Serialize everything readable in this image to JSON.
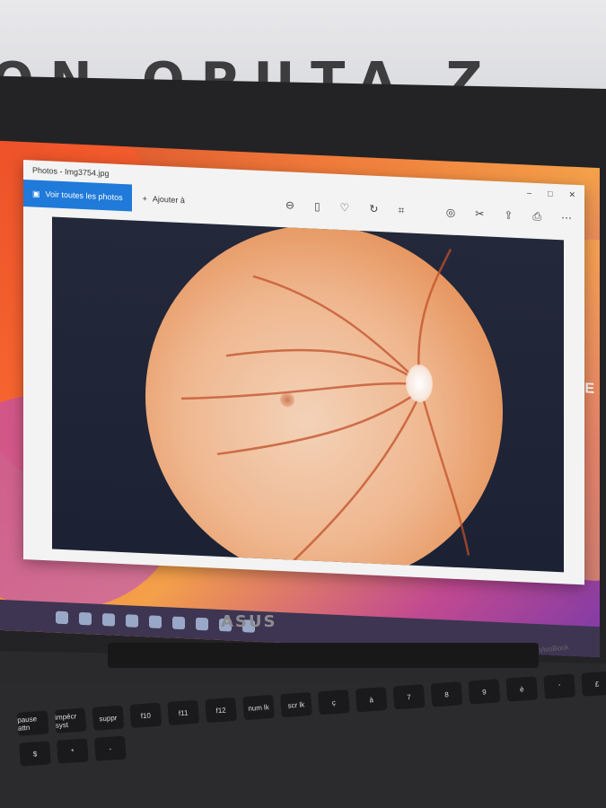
{
  "wall": {
    "sign_text": "ON  OPUTA Z"
  },
  "window": {
    "title": "Photos - Img3754.jpg",
    "controls": [
      "–",
      "□",
      "✕"
    ],
    "see_all": "Voir toutes les photos",
    "add_to": "Ajouter à"
  },
  "desktop": {
    "edible_text": "EDIBLE"
  },
  "laptop": {
    "brand": "ASUS",
    "model": "VivoBook"
  },
  "keyboard": {
    "keys": [
      "pause attn",
      "impécr syst",
      "suppr",
      "f10",
      "f11",
      "f12",
      "num lk",
      "scr lk",
      "ç",
      "à",
      "7",
      "8",
      "9",
      "è",
      "'",
      "£",
      "$",
      "*",
      "-"
    ]
  }
}
